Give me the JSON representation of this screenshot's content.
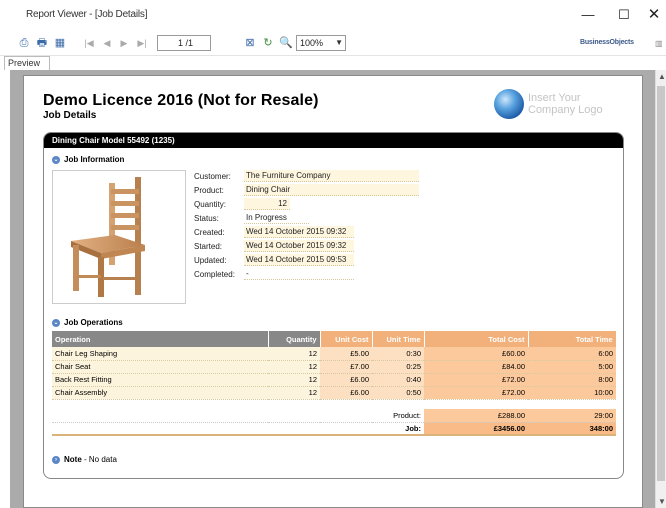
{
  "window": {
    "title": "Report Viewer - [Job Details]",
    "min_glyph": "—",
    "max_glyph": "☐",
    "close_glyph": "✕"
  },
  "toolbar": {
    "page_value": "1 /1",
    "zoom_value": "100%",
    "brand": "BusinessObjects"
  },
  "tabs": {
    "preview": "Preview"
  },
  "report": {
    "title": "Demo Licence 2016 (Not for Resale)",
    "subtitle": "Job Details",
    "logo_line1": "Insert Your",
    "logo_line2": "Company Logo",
    "panel_title": "Dining Chair Model 55492 (1235)",
    "job_info": {
      "heading": "Job Information",
      "fields": [
        {
          "label": "Customer:",
          "value": "The Furniture Company"
        },
        {
          "label": "Product:",
          "value": "Dining Chair"
        },
        {
          "label": "Quantity:",
          "value": "12"
        },
        {
          "label": "Status:",
          "value": "In Progress"
        },
        {
          "label": "Created:",
          "value": "Wed 14 October 2015  09:32"
        },
        {
          "label": "Started:",
          "value": "Wed 14 October 2015  09:32"
        },
        {
          "label": "Updated:",
          "value": "Wed 14 October 2015  09:53"
        },
        {
          "label": "Completed:",
          "value": "-"
        }
      ]
    },
    "operations": {
      "heading": "Job Operations",
      "columns": [
        "Operation",
        "Quantity",
        "Unit Cost",
        "Unit Time",
        "Total Cost",
        "Total Time"
      ],
      "rows": [
        [
          "Chair Leg Shaping",
          "12",
          "£5.00",
          "0:30",
          "£60.00",
          "6:00"
        ],
        [
          "Chair Seat",
          "12",
          "£7.00",
          "0:25",
          "£84.00",
          "5:00"
        ],
        [
          "Back Rest Fitting",
          "12",
          "£6.00",
          "0:40",
          "£72.00",
          "8:00"
        ],
        [
          "Chair Assembly",
          "12",
          "£6.00",
          "0:50",
          "£72.00",
          "10:00"
        ]
      ],
      "product_label": "Product:",
      "product_cost": "£288.00",
      "product_time": "29:00",
      "job_label": "Job:",
      "job_cost": "£3456.00",
      "job_time": "348:00"
    },
    "note": {
      "heading": "Note",
      "text": " - No data"
    }
  }
}
